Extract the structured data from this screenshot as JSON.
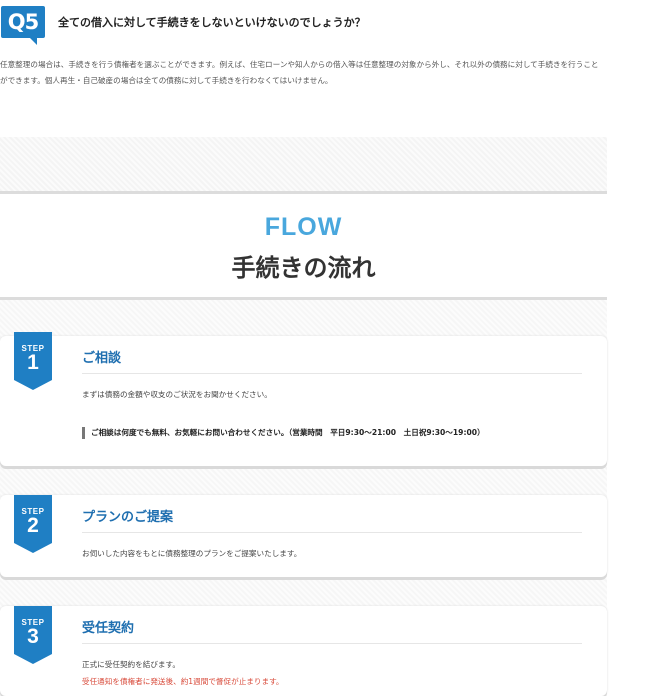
{
  "faq": {
    "badge": "Q5",
    "question": "全ての借入に対して手続きをしないといけないのでしょうか？",
    "answer": "任意整理の場合は、手続きを行う債権者を選ぶことができます。例えば、住宅ローンや知人からの借入等は任意整理の対象から外し、それ以外の債務に対して手続きを行うことができます。個人再生・自己破産の場合は全ての債務に対して手続きを行わなくてはいけません。"
  },
  "flow": {
    "title_en": "FLOW",
    "title_jp": "手続きの流れ",
    "steps": [
      {
        "label": "STEP",
        "number": "1",
        "title": "ご相談",
        "desc": "まずは債務の金額や収支のご状況をお聞かせください。",
        "note": "ご相談は何度でも無料、お気軽にお問い合わせください。（営業時間　平日9:30～21:00　土日祝9:30～19:00）"
      },
      {
        "label": "STEP",
        "number": "2",
        "title": "プランのご提案",
        "desc": "お伺いした内容をもとに債務整理のプランをご提案いたします。"
      },
      {
        "label": "STEP",
        "number": "3",
        "title": "受任契約",
        "desc": "正式に受任契約を結びます。",
        "note_red": "受任通知を債権者に発送後、約1週間で督促が止まります。"
      }
    ]
  },
  "colors": {
    "accent": "#1f7fc4",
    "flow_en": "#49a7dd",
    "step_title": "#1f6fb0",
    "red": "#d84a3a"
  }
}
